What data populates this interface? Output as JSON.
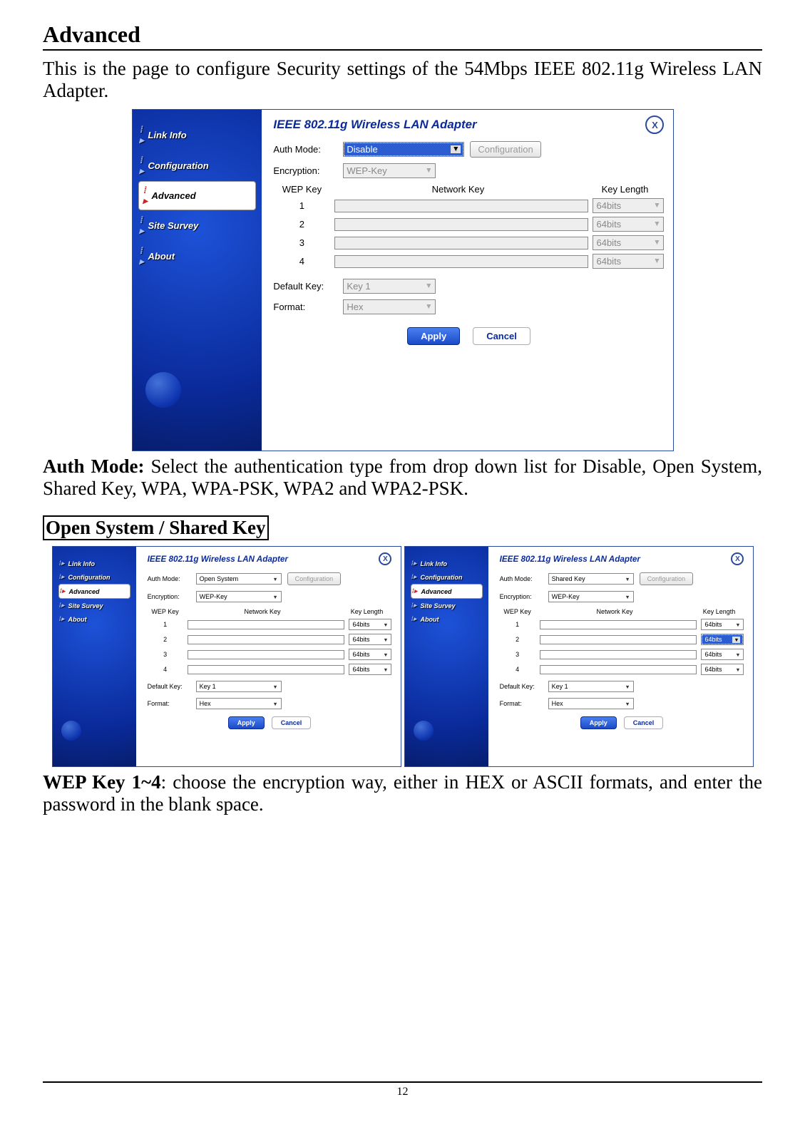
{
  "page": {
    "heading": "Advanced",
    "intro": "This is the page to configure Security settings of the 54Mbps IEEE 802.11g Wireless LAN Adapter.",
    "auth_desc_prefix": "Auth Mode:",
    "auth_desc_body": " Select the authentication type from drop down list for Disable, Open System, Shared Key, WPA, WPA-PSK, WPA2 and WPA2-PSK.",
    "subsection": "Open System / Shared Key",
    "wep_desc_prefix": "WEP Key 1~4",
    "wep_desc_body": ": choose the encryption way, either in HEX or ASCII formats, and enter the password in the blank space.",
    "page_number": "12"
  },
  "shot_common": {
    "title": "IEEE 802.11g Wireless LAN Adapter",
    "nav": [
      "Link Info",
      "Configuration",
      "Advanced",
      "Site Survey",
      "About"
    ],
    "nav_active": "Advanced",
    "labels": {
      "auth": "Auth Mode:",
      "encryption": "Encryption:",
      "wep_key": "WEP Key",
      "network_key": "Network Key",
      "key_length": "Key Length",
      "default_key": "Default Key:",
      "format": "Format:",
      "config_btn": "Configuration",
      "apply": "Apply",
      "cancel": "Cancel",
      "close": "X"
    },
    "wep_indices": [
      "1",
      "2",
      "3",
      "4"
    ],
    "key_length_value": "64bits",
    "encryption_value": "WEP-Key",
    "default_key_value": "Key 1",
    "format_value": "Hex"
  },
  "shot1": {
    "auth_value": "Disable",
    "fields_disabled": true
  },
  "shot2": {
    "auth_value": "Open System",
    "fields_disabled": false
  },
  "shot3": {
    "auth_value": "Shared Key",
    "fields_disabled": false,
    "highlight_row": 2
  }
}
